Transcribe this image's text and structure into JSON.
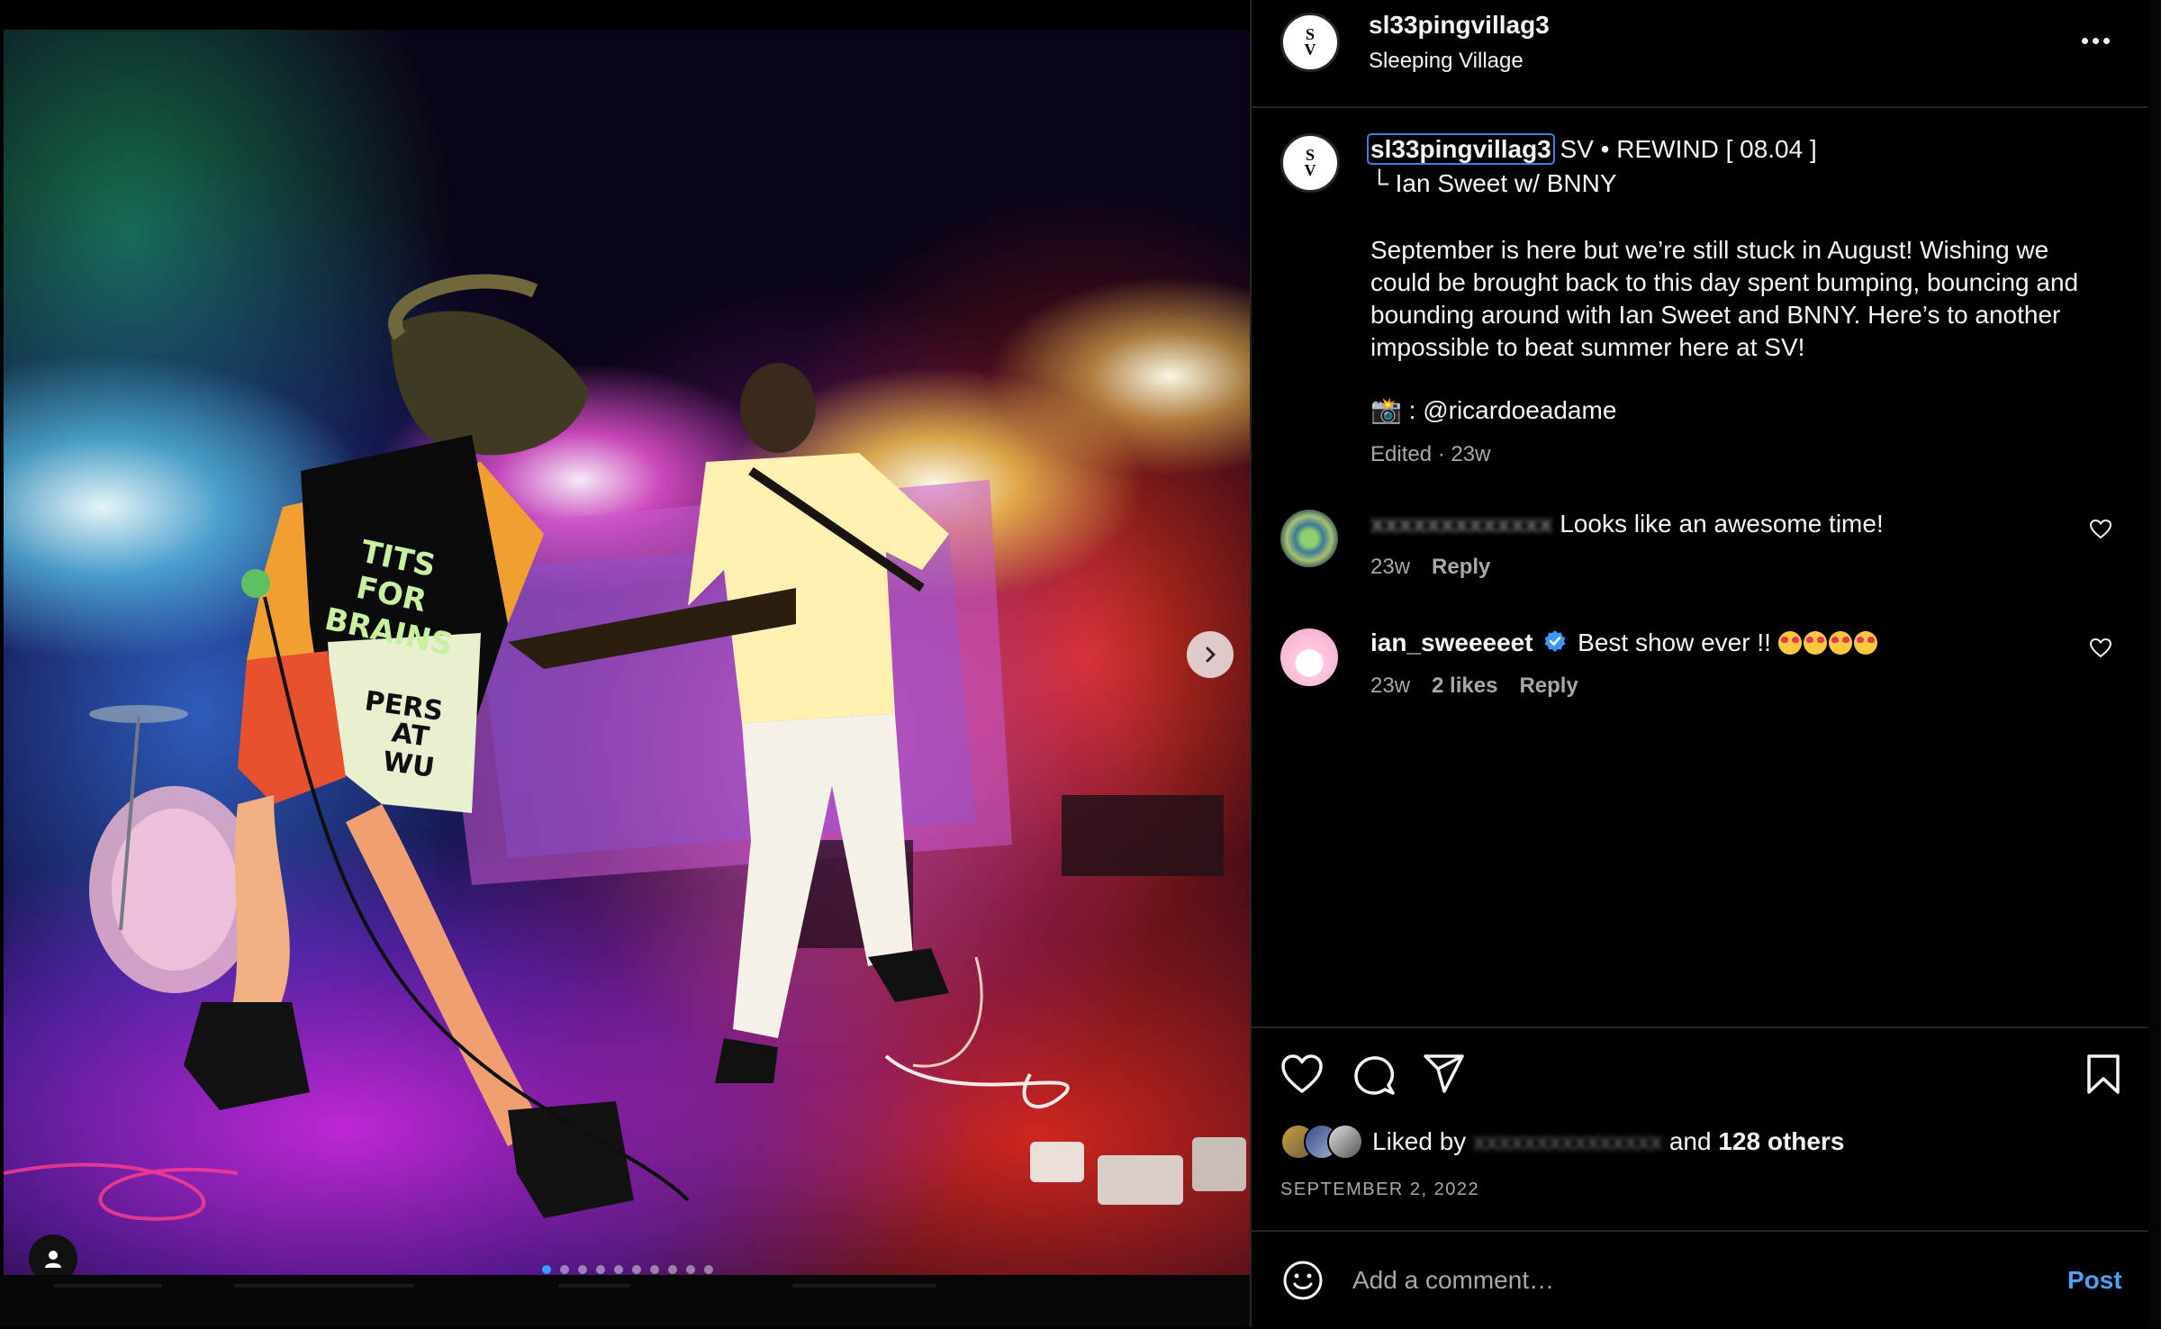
{
  "post": {
    "username": "sl33pingvillag3",
    "display_name": "Sleeping Village",
    "avatar_text": [
      "S",
      "V"
    ],
    "caption": {
      "title": "SV • REWIND [ 08.04 ]",
      "subtitle": "└ Ian Sweet w/ BNNY",
      "body": "September is here but we’re still stuck in August! Wishing we could be brought back to this day spent bumping, bouncing and bounding around with Ian Sweet and BNNY. Here’s to another impossible to beat summer here at SV!",
      "credit": "📸 : @ricardoeadame",
      "meta": "Edited · 23w"
    },
    "image": {
      "shirt_text": [
        "TITS",
        "FOR",
        "BRAINS"
      ],
      "shirt_text_lower": [
        "PERS",
        "AT",
        "WU"
      ],
      "carousel_count": 10,
      "carousel_active": 1
    }
  },
  "comments": [
    {
      "user": "xxxxxxxxxxxxx",
      "user_blurred": true,
      "text": "Looks like an awesome time!",
      "time": "23w",
      "likes": "",
      "reply": "Reply"
    },
    {
      "user": "ian_sweeeeet",
      "verified": true,
      "text": "Best show ever !!",
      "emoji_count": 4,
      "time": "23w",
      "likes": "2 likes",
      "reply": "Reply"
    }
  ],
  "likes": {
    "prefix": "Liked by",
    "blurred_user": "xxxxxxxxxxxxxxx",
    "suffix": "and",
    "others": "128 others"
  },
  "date": "SEPTEMBER 2, 2022",
  "add_comment": {
    "placeholder": "Add a comment…",
    "post_label": "Post"
  },
  "icons": [
    "chevron-right-icon",
    "person-icon",
    "more-icon",
    "heart-icon",
    "comment-icon",
    "share-icon",
    "bookmark-icon",
    "emoji-icon",
    "verified-icon"
  ],
  "colors": {
    "background": "#000000",
    "text": "#f5f5f5",
    "secondary_text": "#a8a8a8",
    "link_blue": "#4aa3f5",
    "divider": "#262626"
  }
}
